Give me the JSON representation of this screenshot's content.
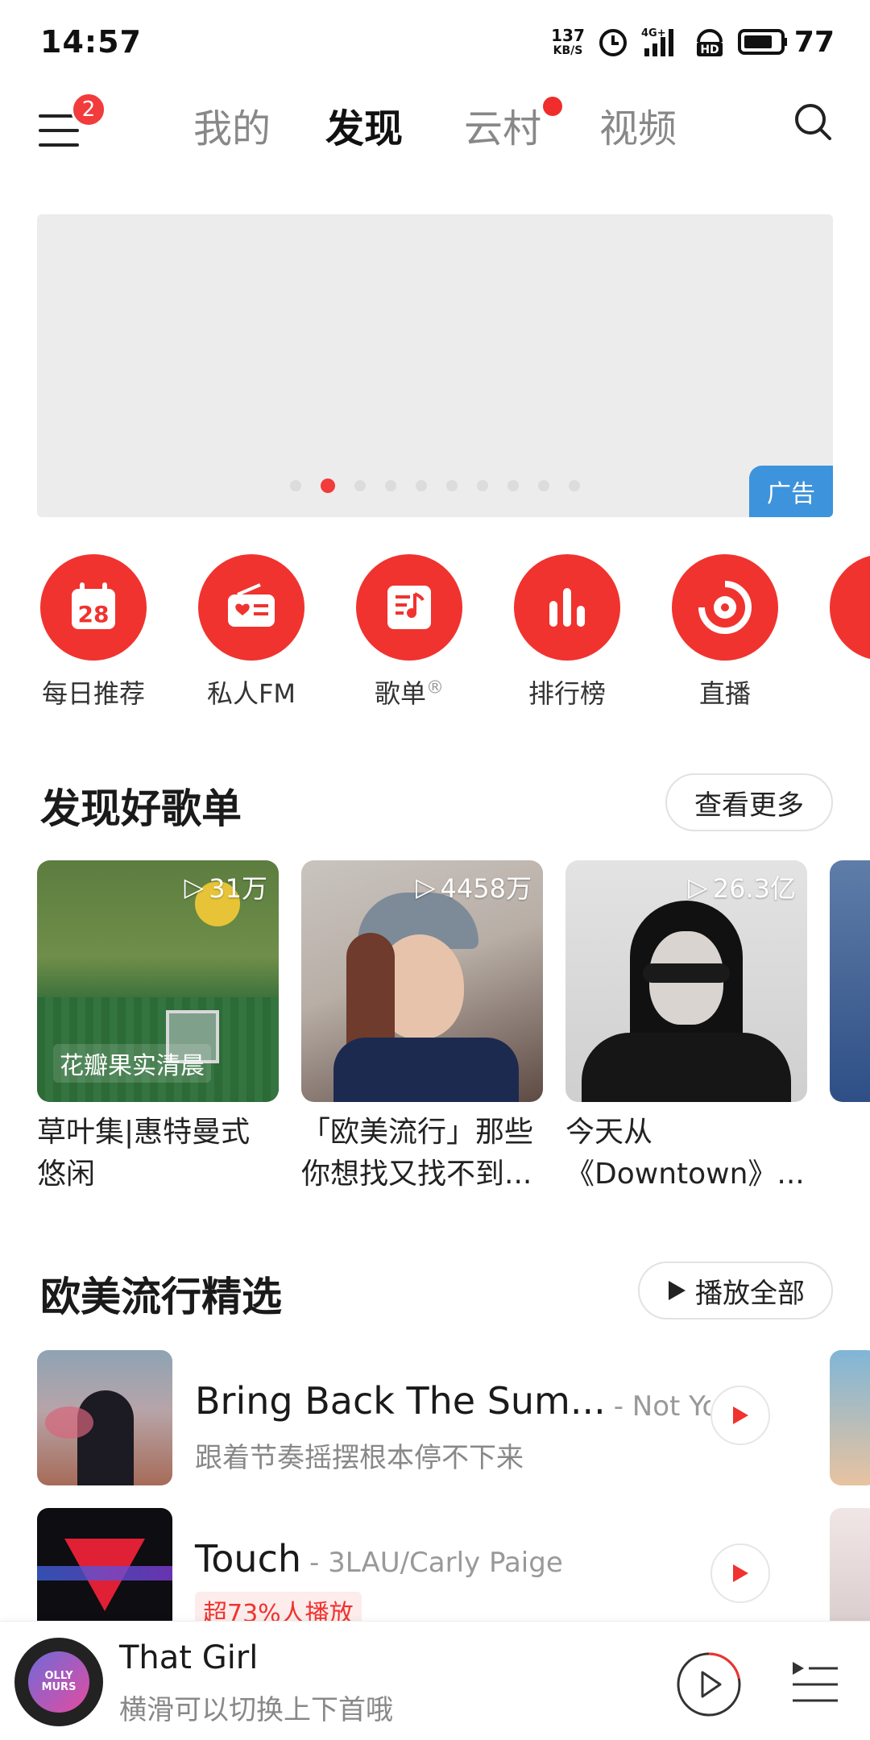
{
  "status": {
    "time": "14:57",
    "net_speed_value": "137",
    "net_speed_unit": "KB/S",
    "network": "4G+",
    "hd": "HD",
    "battery": "77"
  },
  "nav": {
    "menu_badge": "2",
    "tabs": [
      {
        "label": "我的"
      },
      {
        "label": "发现"
      },
      {
        "label": "云村"
      },
      {
        "label": "视频"
      }
    ]
  },
  "banner": {
    "ad_label": "广告",
    "dot_count": 10,
    "active_dot": 2
  },
  "quick": [
    {
      "label": "每日推荐",
      "icon": "calendar-icon",
      "num": "28"
    },
    {
      "label": "私人FM",
      "icon": "radio-icon"
    },
    {
      "label": "歌单",
      "icon": "playlist-icon",
      "mark": "®"
    },
    {
      "label": "排行榜",
      "icon": "chart-bars-icon"
    },
    {
      "label": "直播",
      "icon": "live-icon"
    }
  ],
  "playlists_section": {
    "title": "发现好歌单",
    "more": "查看更多",
    "items": [
      {
        "plays": "31万",
        "name": "草叶集|惠特曼式悠闲",
        "cover_label": "花瓣果实清晨"
      },
      {
        "plays": "4458万",
        "name": "「欧美流行」那些你想找又找不到..."
      },
      {
        "plays": "26.3亿",
        "name": "今天从《Downtown》..."
      }
    ]
  },
  "songs_section": {
    "title": "欧美流行精选",
    "play_all": "播放全部",
    "songs": [
      {
        "title": "Bring Back The Sum...",
        "artist": "- Not Yo...",
        "sub": "跟着节奏摇摆根本停不下来"
      },
      {
        "title": "Touch",
        "artist": "- 3LAU/Carly Paige",
        "badge": "超73%人播放"
      }
    ]
  },
  "player": {
    "title": "That Girl",
    "subtitle": "横滑可以切换上下首哦",
    "disc_text": "OLLY MURS",
    "progress": 0.22
  },
  "colors": {
    "brand_red": "#f0332f",
    "ad_blue": "#3d93dc"
  }
}
